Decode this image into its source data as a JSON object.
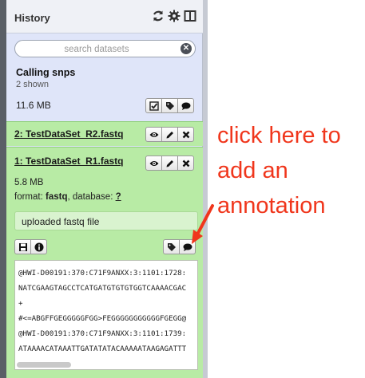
{
  "history": {
    "title": "History",
    "search": {
      "placeholder": "search datasets"
    },
    "name": "Calling snps",
    "shown": "2 shown",
    "size": "11.6 MB"
  },
  "datasets": [
    {
      "title": "2: TestDataSet_R2.fastq"
    },
    {
      "title": "1: TestDataSet_R1.fastq",
      "size": "5.8 MB",
      "format_label": "format:",
      "format_value": "fastq",
      "database_label": ", database:",
      "database_value": "?",
      "annotation": "uploaded fastq file",
      "peek": [
        "@HWI-D00191:370:C71F9ANXX:3:1101:1728:",
        "NATCGAAGTAGCCTCATGATGTGTGTGGTCAAAACGAC",
        "+",
        "#<=ABGFFGEGGGGGFGG>FEGGGGGGGGGGGFGEGG@",
        "@HWI-D00191:370:C71F9ANXX:3:1101:1739:",
        "ATAAAACATAAATTGATATATACAAAAATAAGAGATTT"
      ]
    }
  ],
  "instruction": {
    "line1": "click here to",
    "line2": "add an",
    "line3": "annotation",
    "color": "#f0361c"
  },
  "icons": [
    "refresh-icon",
    "gear-icon",
    "columns-icon",
    "clear-search-icon",
    "checkbox-icon",
    "tags-icon",
    "comment-icon",
    "eye-icon",
    "pencil-icon",
    "delete-icon",
    "save-icon",
    "info-icon"
  ]
}
